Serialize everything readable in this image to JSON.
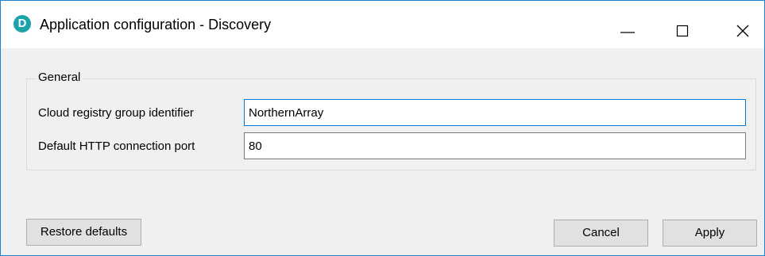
{
  "window": {
    "title": "Application configuration - Discovery",
    "app_icon_letter": "D",
    "accent_color": "#1883d7",
    "app_icon_color": "#1aa3a8",
    "controls": {
      "minimize_icon": "minimize-icon",
      "maximize_icon": "maximize-icon",
      "close_icon": "close-icon"
    }
  },
  "group": {
    "legend": "General",
    "fields": [
      {
        "label": "Cloud registry group identifier",
        "value": "NorthernArray",
        "focused": true
      },
      {
        "label": "Default HTTP connection port",
        "value": "80",
        "focused": false
      }
    ]
  },
  "buttons": {
    "restore_defaults": "Restore defaults",
    "cancel": "Cancel",
    "apply": "Apply"
  }
}
